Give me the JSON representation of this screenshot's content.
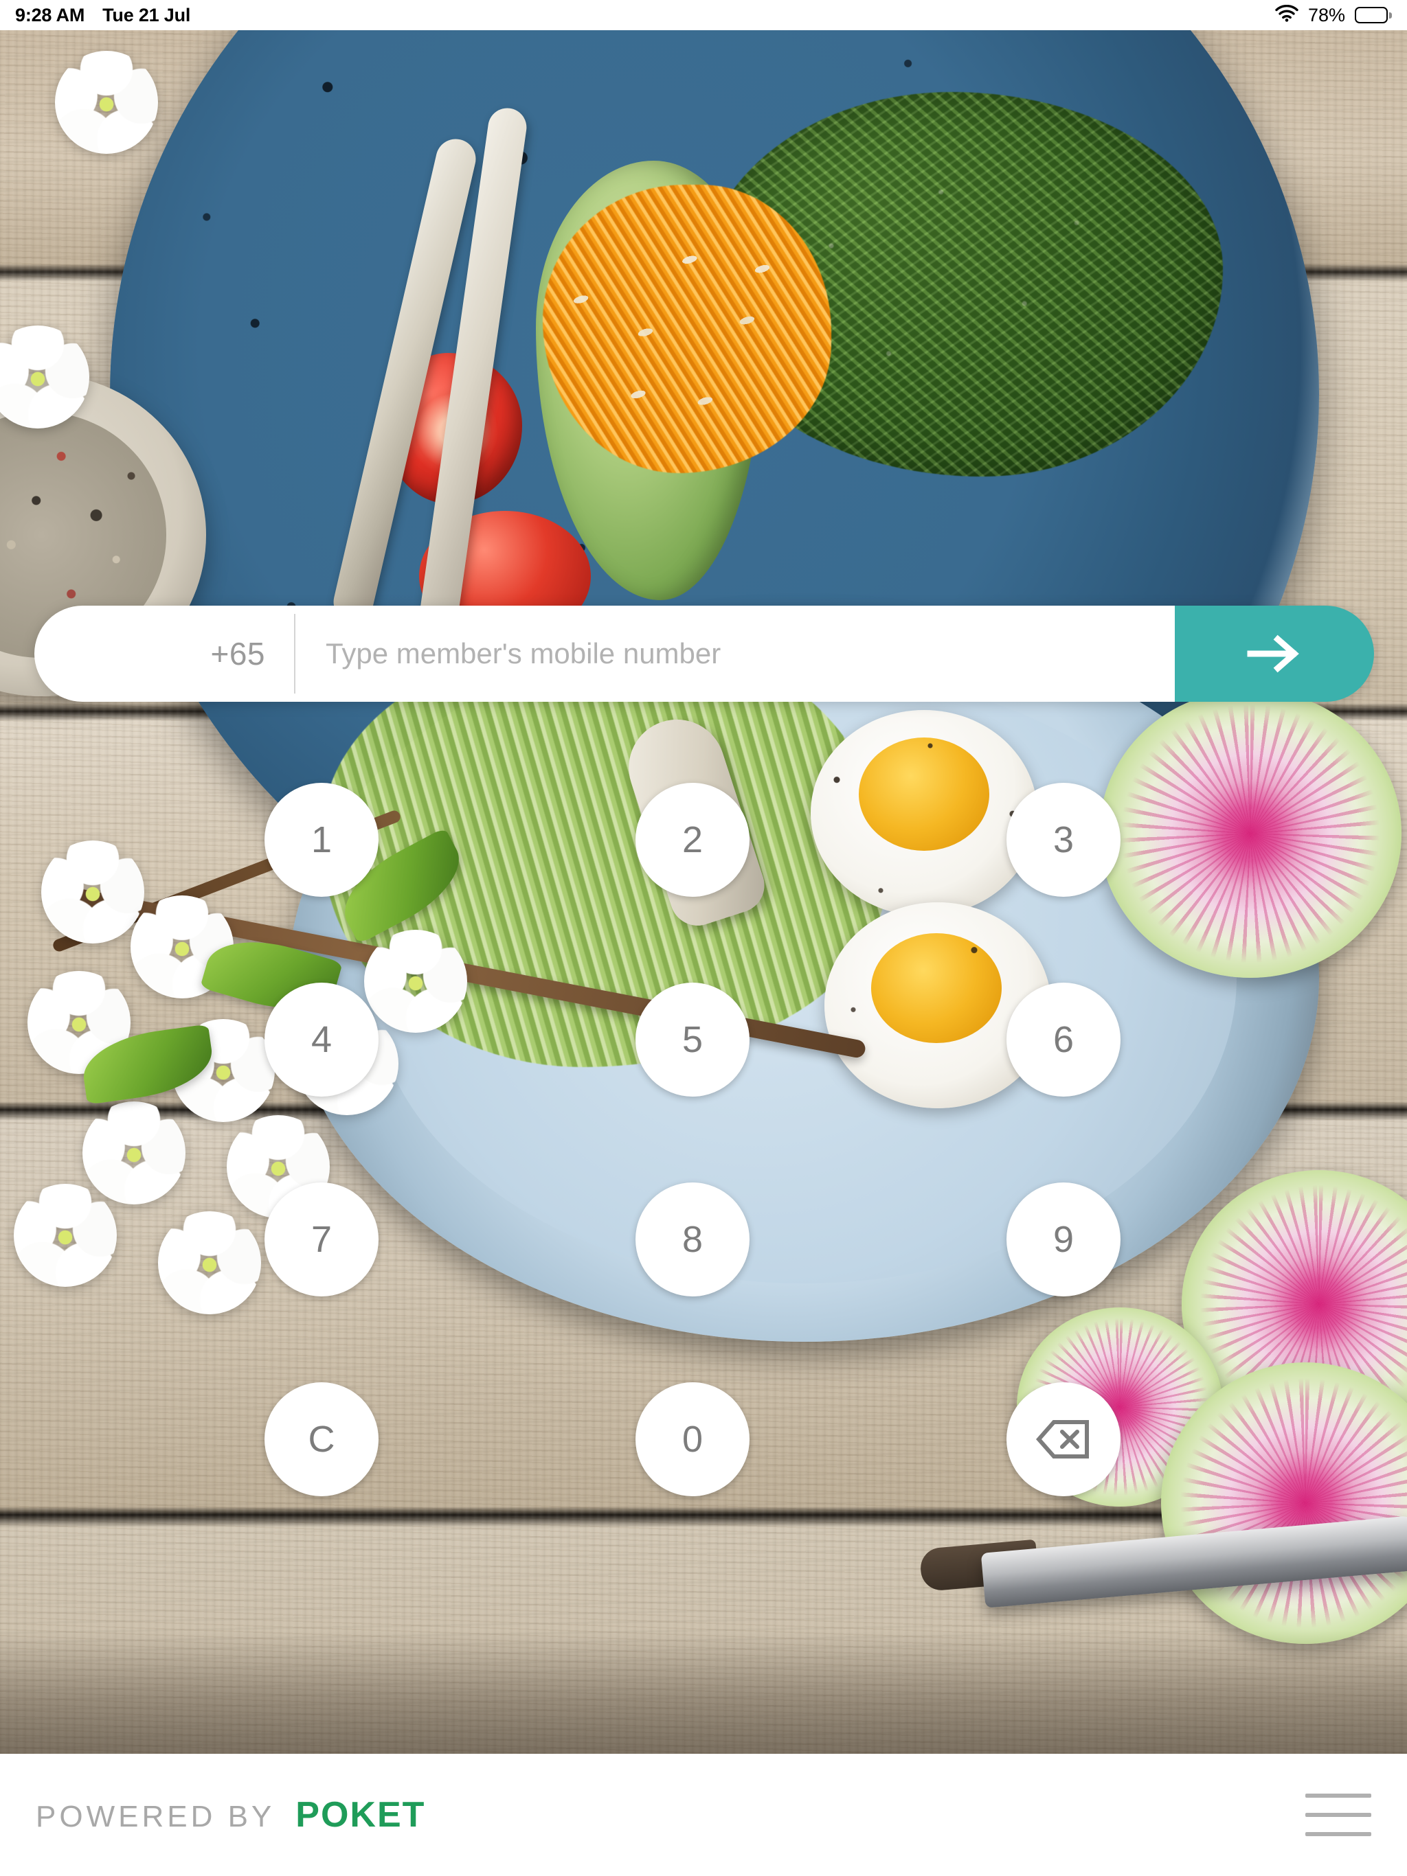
{
  "status_bar": {
    "time": "9:28 AM",
    "date": "Tue 21 Jul",
    "battery_percent": "78%",
    "battery_level": 78,
    "wifi_icon": "wifi-icon",
    "battery_icon": "battery-icon"
  },
  "entry": {
    "country_code": "+65",
    "placeholder": "Type member's mobile number",
    "value": "",
    "submit_icon": "arrow-right-icon",
    "submit_color": "#3bb1ac"
  },
  "keypad": {
    "keys": [
      {
        "label": "1",
        "name": "key-1",
        "type": "digit"
      },
      {
        "label": "2",
        "name": "key-2",
        "type": "digit"
      },
      {
        "label": "3",
        "name": "key-3",
        "type": "digit"
      },
      {
        "label": "4",
        "name": "key-4",
        "type": "digit"
      },
      {
        "label": "5",
        "name": "key-5",
        "type": "digit"
      },
      {
        "label": "6",
        "name": "key-6",
        "type": "digit"
      },
      {
        "label": "7",
        "name": "key-7",
        "type": "digit"
      },
      {
        "label": "8",
        "name": "key-8",
        "type": "digit"
      },
      {
        "label": "9",
        "name": "key-9",
        "type": "digit"
      },
      {
        "label": "C",
        "name": "key-clear",
        "type": "clear"
      },
      {
        "label": "0",
        "name": "key-0",
        "type": "digit"
      },
      {
        "label": "",
        "name": "key-backspace",
        "type": "backspace",
        "icon": "backspace-icon"
      }
    ]
  },
  "footer": {
    "powered_by": "POWERED BY",
    "brand": "POKET",
    "brand_color": "#1f9c59",
    "menu_icon": "hamburger-menu-icon"
  }
}
